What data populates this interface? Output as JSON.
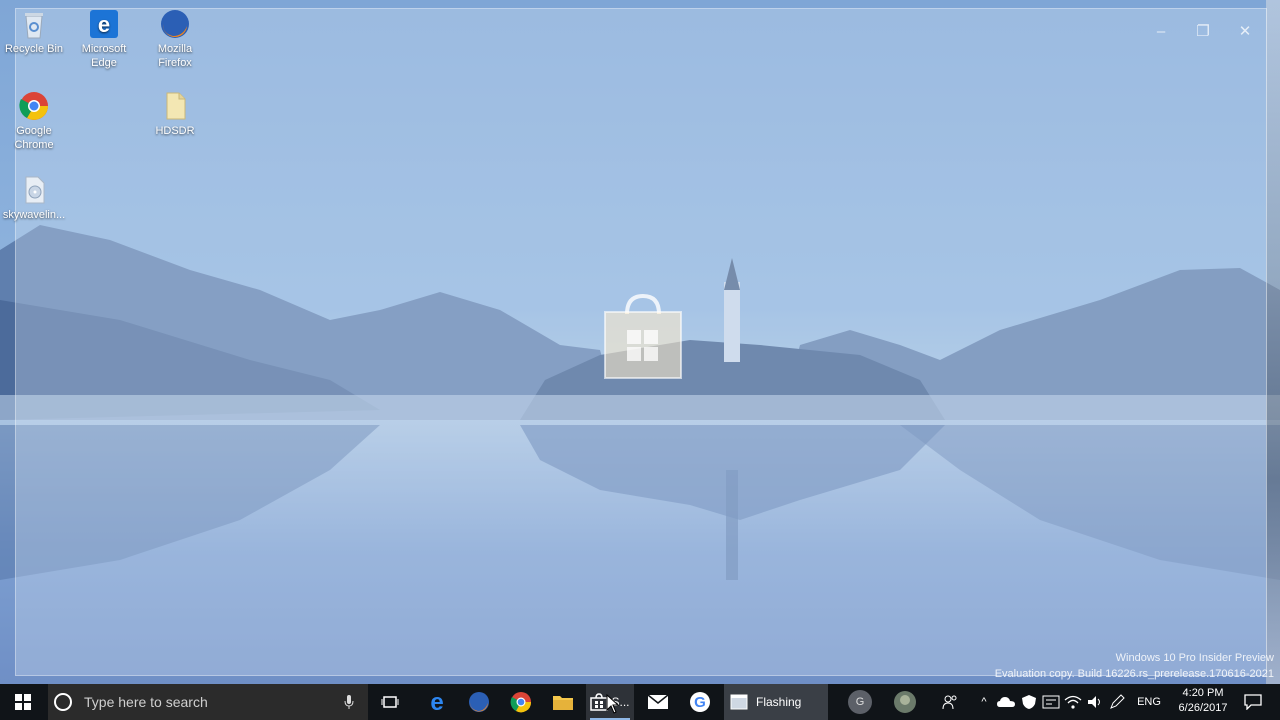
{
  "desktop": {
    "icons": [
      {
        "label": "Recycle Bin",
        "icon": "recycle-bin-icon"
      },
      {
        "label": "Microsoft\nEdge",
        "icon": "edge-icon"
      },
      {
        "label": "Mozilla\nFirefox",
        "icon": "firefox-icon"
      },
      {
        "label": "Google\nChrome",
        "icon": "chrome-icon"
      },
      {
        "label": "HDSDR",
        "icon": "file-icon"
      },
      {
        "label": "skywavelin...",
        "icon": "file-icon"
      }
    ]
  },
  "splash": {
    "controls": {
      "minimize": "‒",
      "restore": "❐",
      "close": "✕"
    }
  },
  "watermark": {
    "line1": "Windows 10 Pro Insider Preview",
    "line2": "Evaluation copy. Build 16226.rs_prerelease.170616-2021"
  },
  "taskbar": {
    "search_placeholder": "Type here to search",
    "store_label": "S...",
    "flashing_label": "Flashing",
    "avatar_letter": "G",
    "language": "ENG",
    "time": "4:20 PM",
    "date": "6/26/2017"
  },
  "colors": {
    "taskbar": "#101418",
    "accent": "#8fb7e6"
  }
}
